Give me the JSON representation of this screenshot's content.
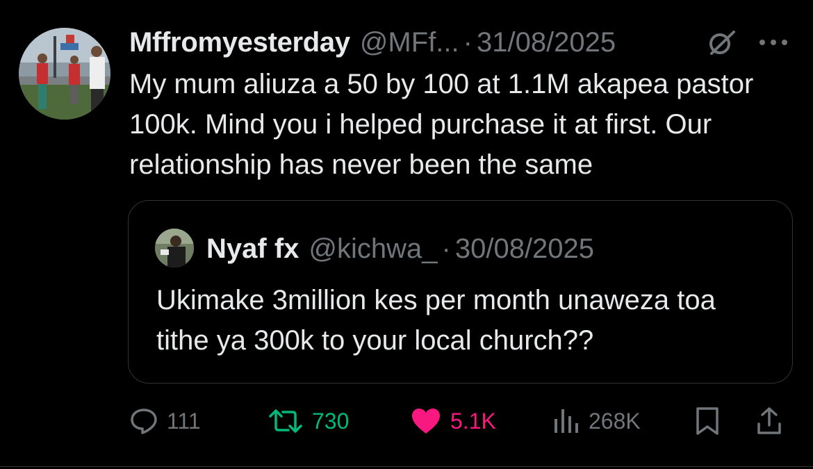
{
  "tweet": {
    "author": {
      "display_name": "Mffromyesterday",
      "handle": "@MFf...",
      "separator": "·",
      "date": "31/08/2025"
    },
    "text": "My mum aliuza a 50 by 100 at 1.1M akapea pastor 100k. Mind you i helped purchase it at first. Our relationship has never been the same",
    "quoted": {
      "display_name": "Nyaf fx",
      "handle": "@kichwa_",
      "separator": "·",
      "date": "30/08/2025",
      "text": "Ukimake 3million kes per month unaweza toa tithe ya 300k to your local church??"
    },
    "metrics": {
      "replies": "111",
      "reposts": "730",
      "likes": "5.1K",
      "views": "268K"
    }
  },
  "icons": {
    "grok": "grok-icon",
    "more": "more-options-icon",
    "reply": "reply-icon",
    "repost": "repost-icon",
    "like": "heart-icon",
    "views": "views-chart-icon",
    "bookmark": "bookmark-icon",
    "share": "share-icon"
  },
  "colors": {
    "background": "#000000",
    "primary_text": "#e7e9ea",
    "secondary_text": "#71767b",
    "repost_active": "#00ba7c",
    "like_active": "#f91880",
    "border": "#2f3336"
  }
}
